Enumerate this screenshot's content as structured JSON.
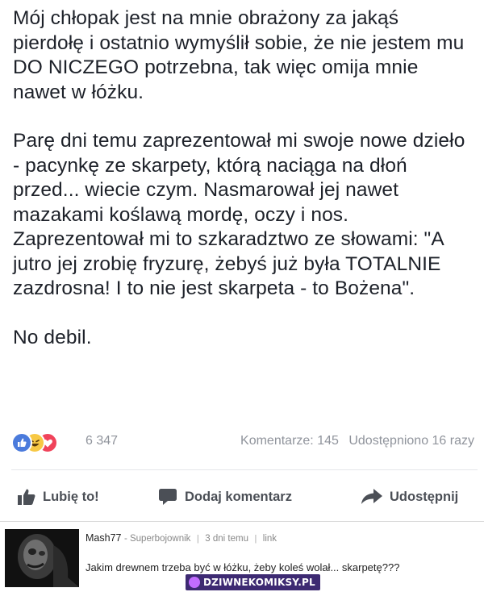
{
  "post": {
    "paragraphs": [
      "Mój chłopak jest na mnie obrażony za jakąś pierdołę i ostatnio wymyślił sobie, że nie jestem mu DO NICZEGO potrzebna, tak więc omija mnie nawet w łóżku.",
      "Parę dni temu zaprezentował mi swoje nowe dzieło - pacynkę ze skarpety, którą naciąga na dłoń przed... wiecie czym. Nasmarował jej nawet mazakami koślawą mordę, oczy i nos. Zaprezentował mi to szkaradztwo ze słowami: \"A jutro jej zrobię fryzurę, żebyś już była TOTALNIE zazdrosna! I to nie jest skarpeta - to Bożena\".",
      "No debil."
    ]
  },
  "reactions": {
    "icons": [
      "like-icon",
      "haha-icon",
      "love-icon"
    ],
    "count": "6 347",
    "comments": "Komentarze: 145",
    "shares": "Udostępniono 16 razy",
    "colors": {
      "like": "#4b7bdc",
      "haha": "#f7c844",
      "love": "#f0435a"
    }
  },
  "actions": {
    "like": "Lubię to!",
    "comment": "Dodaj komentarz",
    "share": "Udostępnij"
  },
  "comment": {
    "username": "Mash77",
    "rank": "- Superbojownik",
    "time": "3 dni temu",
    "link": "link",
    "text": "Jakim drewnem trzeba być w łóżku, żeby koleś wolał... skarpetę???"
  },
  "watermark": {
    "text": "DZIWNEKOMIKSY.PL"
  }
}
